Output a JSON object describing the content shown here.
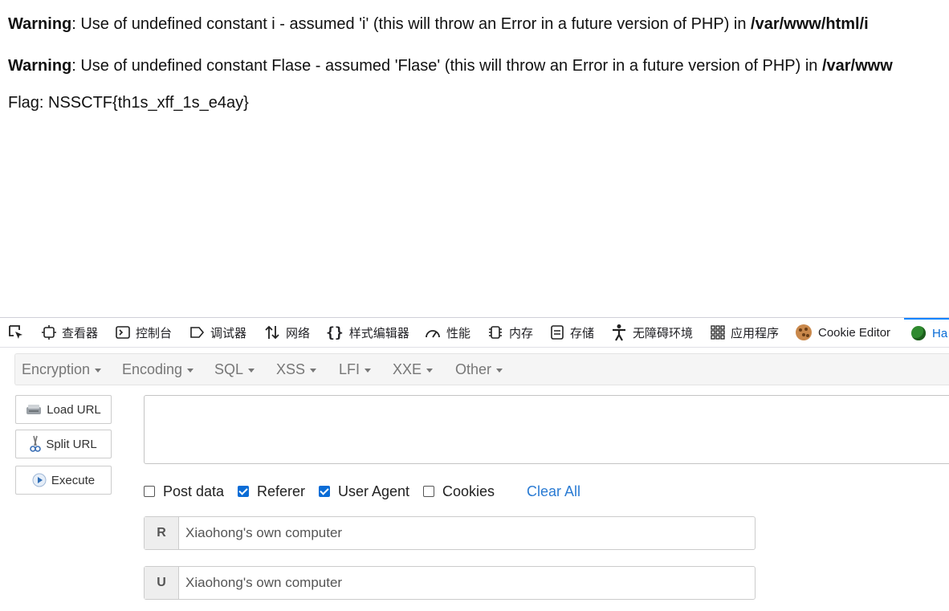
{
  "page": {
    "warnings": [
      {
        "label": "Warning",
        "message": ": Use of undefined constant i - assumed 'i' (this will throw an Error in a future version of PHP) in ",
        "path": "/var/www/html/i"
      },
      {
        "label": "Warning",
        "message": ": Use of undefined constant Flase - assumed 'Flase' (this will throw an Error in a future version of PHP) in ",
        "path": "/var/www"
      }
    ],
    "flag_text": "Flag: NSSCTF{th1s_xff_1s_e4ay}"
  },
  "devtools": {
    "tabs": [
      {
        "label": "查看器",
        "icon": "inspector-icon"
      },
      {
        "label": "控制台",
        "icon": "console-icon"
      },
      {
        "label": "调试器",
        "icon": "debugger-icon"
      },
      {
        "label": "网络",
        "icon": "network-icon"
      },
      {
        "label": "样式编辑器",
        "icon": "style-editor-icon"
      },
      {
        "label": "性能",
        "icon": "performance-icon"
      },
      {
        "label": "内存",
        "icon": "memory-icon"
      },
      {
        "label": "存储",
        "icon": "storage-icon"
      },
      {
        "label": "无障碍环境",
        "icon": "accessibility-icon"
      },
      {
        "label": "应用程序",
        "icon": "application-icon"
      },
      {
        "label": "Cookie Editor",
        "icon": "cookie-icon"
      },
      {
        "label": "Ha",
        "icon": "hackbar-icon"
      }
    ]
  },
  "hackbar": {
    "menu": [
      "Encryption",
      "Encoding",
      "SQL",
      "XSS",
      "LFI",
      "XXE",
      "Other"
    ],
    "buttons": {
      "load_url": "Load URL",
      "split_url": "Split URL",
      "execute": "Execute"
    },
    "url_value": "",
    "options": {
      "post_data": {
        "label": "Post data",
        "checked": false
      },
      "referer": {
        "label": "Referer",
        "checked": true
      },
      "user_agent": {
        "label": "User Agent",
        "checked": true
      },
      "cookies": {
        "label": "Cookies",
        "checked": false
      },
      "clear_all": "Clear All"
    },
    "fields": {
      "referer": {
        "tag": "R",
        "value": "Xiaohong's own computer"
      },
      "user_agent": {
        "tag": "U",
        "value": "Xiaohong's own computer"
      }
    }
  },
  "colors": {
    "accent": "#0a6cd6",
    "link": "#2a7bd3",
    "menu_text": "#777777"
  }
}
